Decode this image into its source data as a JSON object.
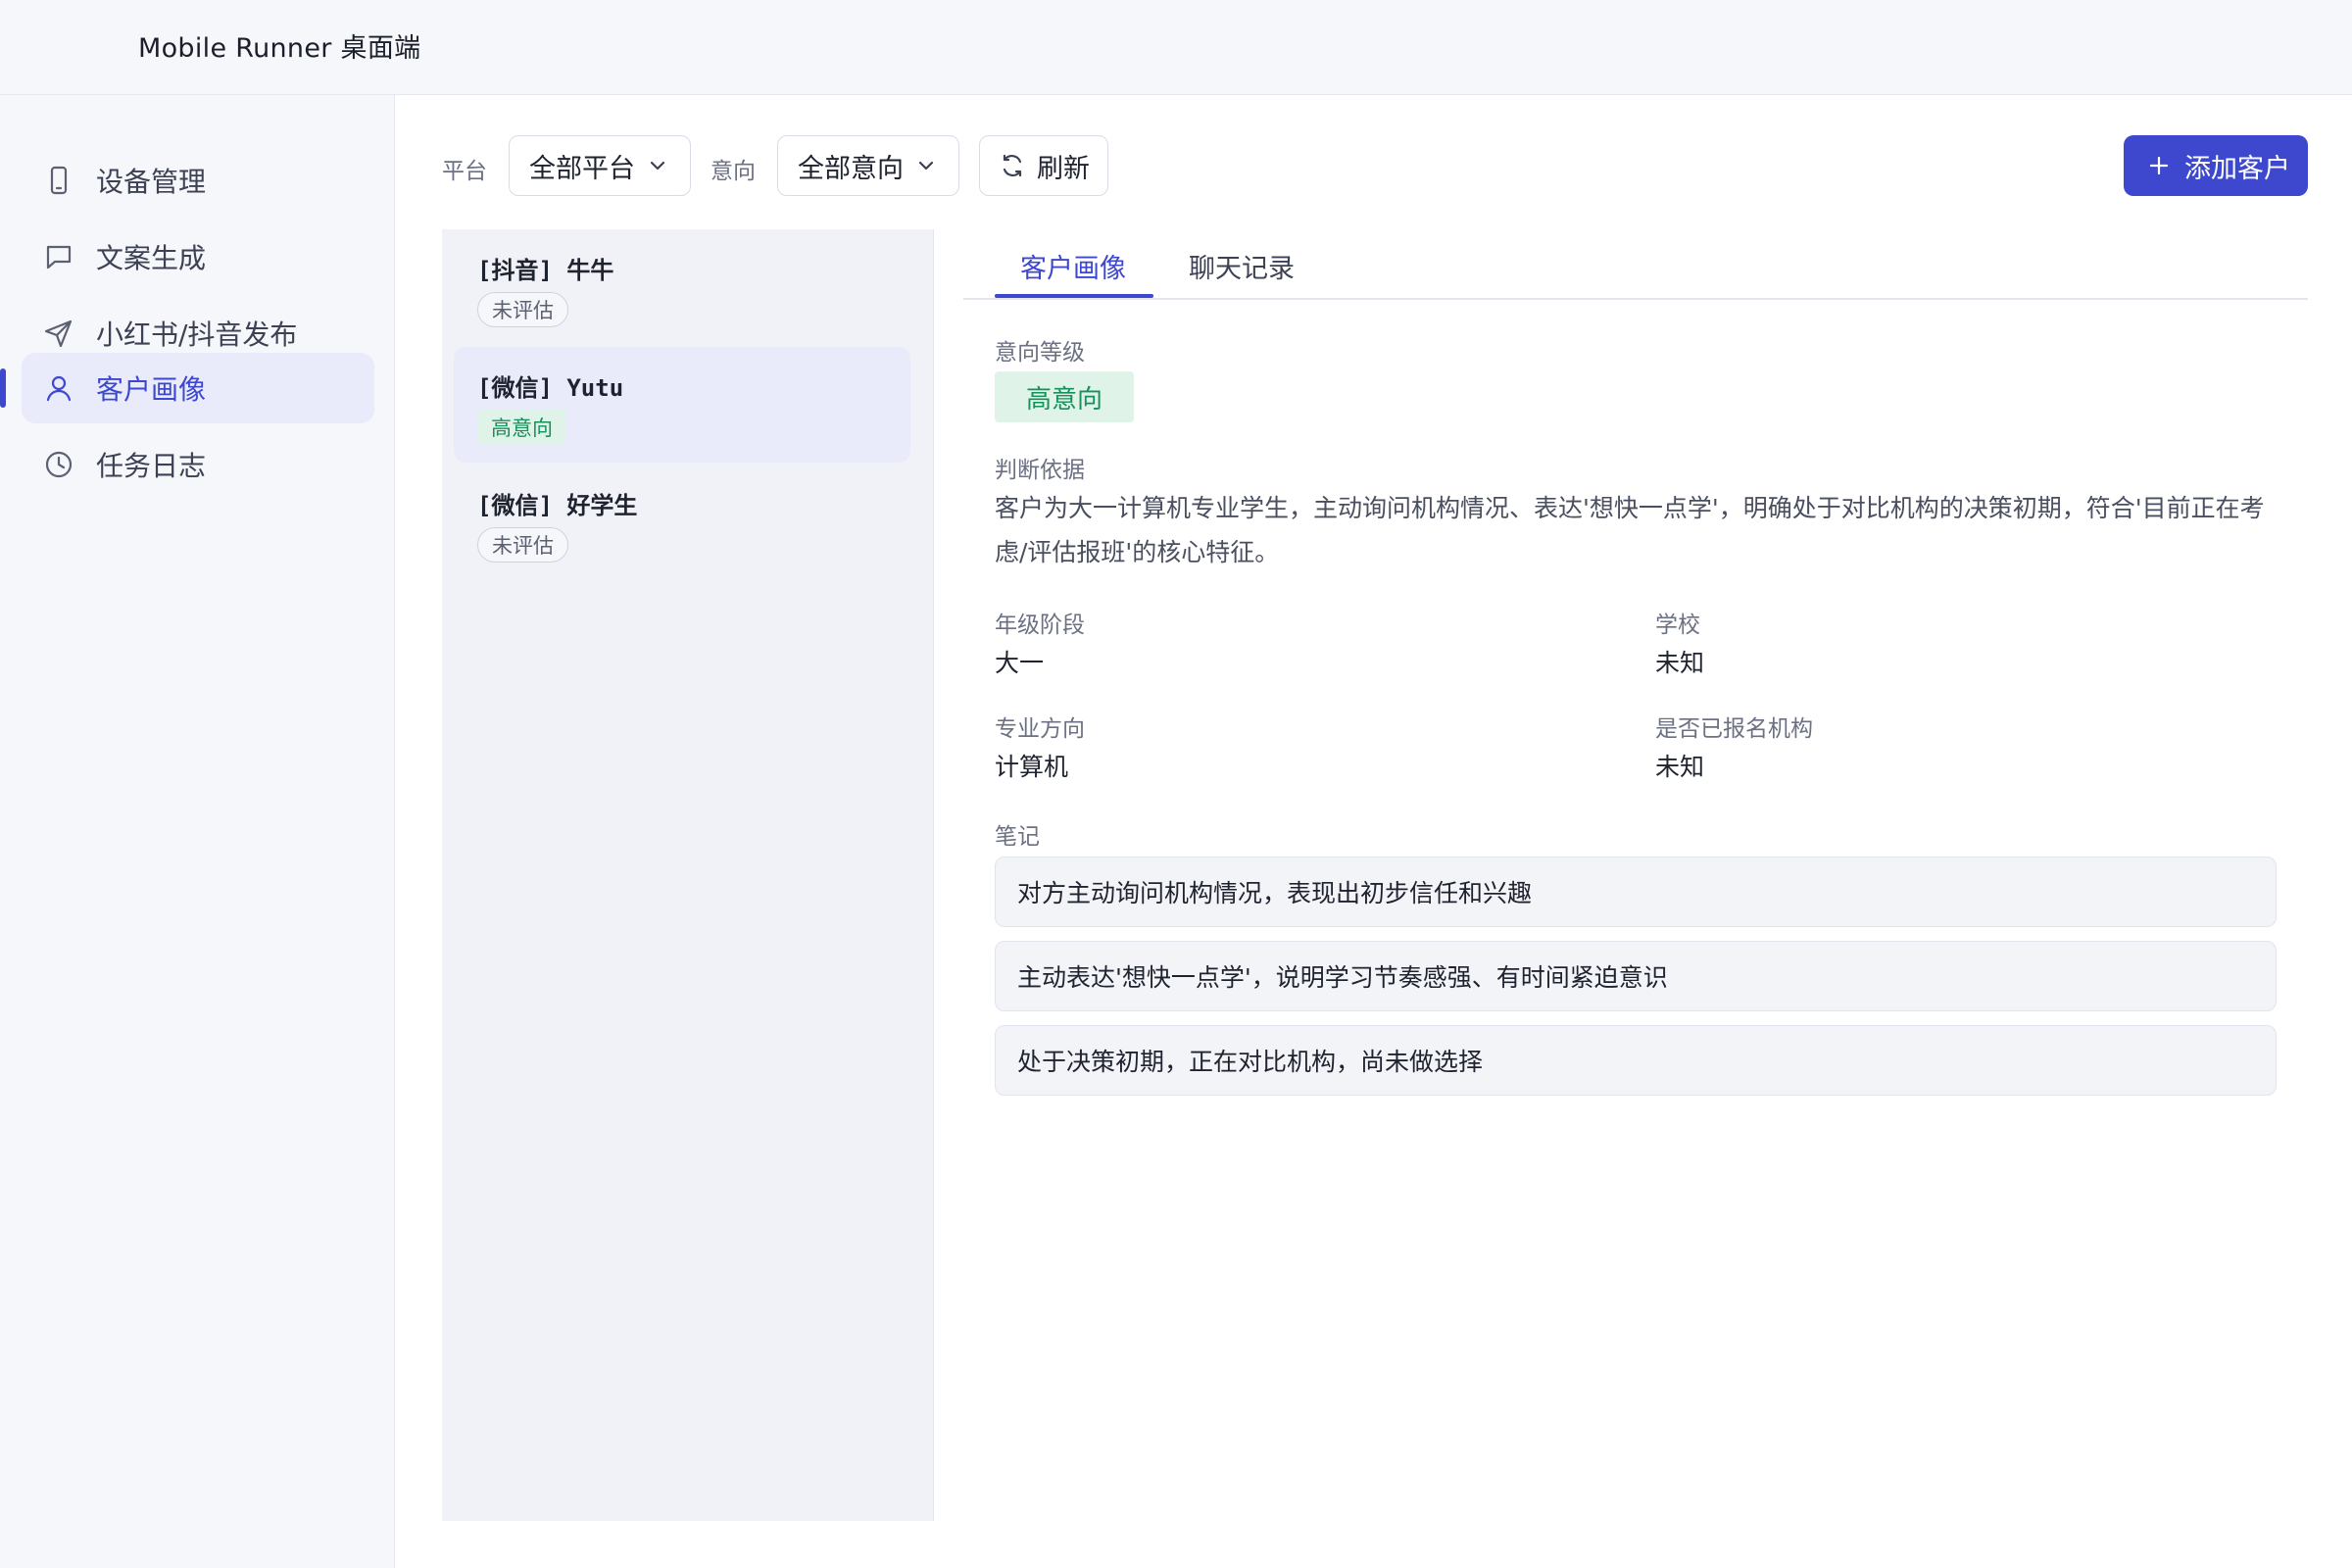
{
  "app": {
    "title": "Mobile Runner 桌面端"
  },
  "sidebar": {
    "items": [
      {
        "label": "设备管理",
        "icon": "phone-icon"
      },
      {
        "label": "文案生成",
        "icon": "chat-icon"
      },
      {
        "label": "小红书/抖音发布",
        "icon": "send-icon"
      },
      {
        "label": "客户画像",
        "icon": "user-icon",
        "active": true
      },
      {
        "label": "任务日志",
        "icon": "clock-icon"
      }
    ]
  },
  "toolbar": {
    "platform_label": "平台",
    "platform_value": "全部平台",
    "intent_label": "意向",
    "intent_value": "全部意向",
    "refresh_label": "刷新",
    "add_label": "添加客户"
  },
  "customers": [
    {
      "name": "[抖音] 牛牛",
      "status": "未评估"
    },
    {
      "name": "[微信] Yutu",
      "status": "高意向",
      "selected": true
    },
    {
      "name": "[微信] 好学生",
      "status": "未评估"
    }
  ],
  "detail": {
    "tabs": [
      {
        "label": "客户画像",
        "active": true
      },
      {
        "label": "聊天记录"
      }
    ],
    "intent_level_label": "意向等级",
    "intent_level_value": "高意向",
    "basis_label": "判断依据",
    "basis_text": "客户为大一计算机专业学生，主动询问机构情况、表达'想快一点学'，明确处于对比机构的决策初期，符合'目前正在考虑/评估报班'的核心特征。",
    "grade_label": "年级阶段",
    "grade_value": "大一",
    "school_label": "学校",
    "school_value": "未知",
    "major_label": "专业方向",
    "major_value": "计算机",
    "enrolled_label": "是否已报名机构",
    "enrolled_value": "未知",
    "notes_label": "笔记",
    "notes": [
      "对方主动询问机构情况，表现出初步信任和兴趣",
      "主动表达'想快一点学'，说明学习节奏感强、有时间紧迫意识",
      "处于决策初期，正在对比机构，尚未做选择"
    ]
  },
  "colors": {
    "accent": "#3d48cf",
    "accent_bg": "#e9ebfa",
    "success": "#16915a",
    "success_bg": "#dff3e8"
  }
}
